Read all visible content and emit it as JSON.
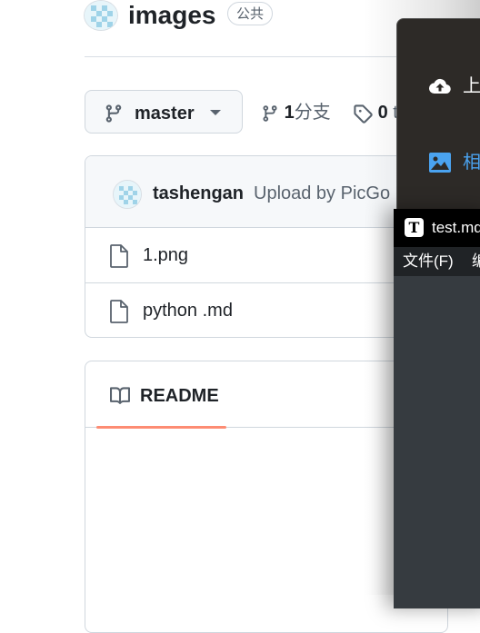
{
  "repo": {
    "name": "images",
    "visibility": "公共"
  },
  "branch": {
    "current": "master",
    "branch_count": "1",
    "branch_label": "分支",
    "tag_count": "0",
    "tag_label_partial": "t"
  },
  "commit": {
    "author": "tashengan",
    "message": "Upload by PicGo"
  },
  "files": [
    {
      "name": "1.png",
      "icon": "file-icon"
    },
    {
      "name": "python .md",
      "icon": "file-icon"
    }
  ],
  "readme": {
    "tab_label": "README"
  },
  "context_menu": {
    "items": [
      {
        "label": "上",
        "icon": "cloud-upload-icon"
      },
      {
        "label": "相",
        "icon": "image-icon"
      }
    ]
  },
  "typora": {
    "logo_letter": "T",
    "window_title": "test.md",
    "menus": [
      "文件(F)",
      "编"
    ]
  },
  "colors": {
    "accent_underline": "#fd8c73",
    "link_blue": "#4aa3f0",
    "typora_bg": "#363b40"
  }
}
